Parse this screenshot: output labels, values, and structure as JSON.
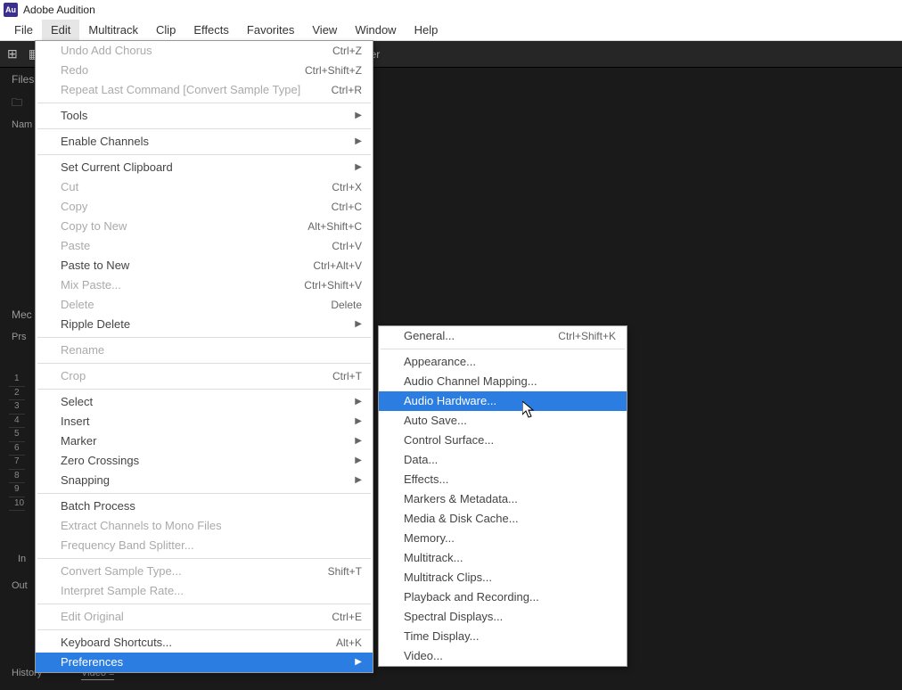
{
  "app": {
    "icon": "Au",
    "title": "Adobe Audition"
  },
  "menubar": [
    "File",
    "Edit",
    "Multitrack",
    "Clip",
    "Effects",
    "Favorites",
    "View",
    "Window",
    "Help"
  ],
  "activeMenu": 1,
  "toolbar": {
    "mixer": "Mixer"
  },
  "side": {
    "files": "Files",
    "name": "Nam",
    "mec": "Mec",
    "prs": "Prs",
    "in": "In",
    "out": "Out",
    "history": "History",
    "video": "Video  ≡"
  },
  "numlist": [
    "1",
    "2",
    "3",
    "4",
    "5",
    "6",
    "7",
    "8",
    "9",
    "10"
  ],
  "editMenu": [
    {
      "label": "Undo Add Chorus",
      "short": "Ctrl+Z",
      "dis": true
    },
    {
      "label": "Redo",
      "short": "Ctrl+Shift+Z",
      "dis": true
    },
    {
      "label": "Repeat Last Command [Convert Sample Type]",
      "short": "Ctrl+R",
      "dis": true
    },
    {
      "sep": true
    },
    {
      "label": "Tools",
      "sub": true
    },
    {
      "sep": true
    },
    {
      "label": "Enable Channels",
      "sub": true
    },
    {
      "sep": true
    },
    {
      "label": "Set Current Clipboard",
      "sub": true
    },
    {
      "label": "Cut",
      "short": "Ctrl+X",
      "dis": true
    },
    {
      "label": "Copy",
      "short": "Ctrl+C",
      "dis": true
    },
    {
      "label": "Copy to New",
      "short": "Alt+Shift+C",
      "dis": true
    },
    {
      "label": "Paste",
      "short": "Ctrl+V",
      "dis": true
    },
    {
      "label": "Paste to New",
      "short": "Ctrl+Alt+V"
    },
    {
      "label": "Mix Paste...",
      "short": "Ctrl+Shift+V",
      "dis": true
    },
    {
      "label": "Delete",
      "short": "Delete",
      "dis": true
    },
    {
      "label": "Ripple Delete",
      "sub": true
    },
    {
      "sep": true
    },
    {
      "label": "Rename",
      "dis": true
    },
    {
      "sep": true
    },
    {
      "label": "Crop",
      "short": "Ctrl+T",
      "dis": true
    },
    {
      "sep": true
    },
    {
      "label": "Select",
      "sub": true
    },
    {
      "label": "Insert",
      "sub": true
    },
    {
      "label": "Marker",
      "sub": true
    },
    {
      "label": "Zero Crossings",
      "sub": true
    },
    {
      "label": "Snapping",
      "sub": true
    },
    {
      "sep": true
    },
    {
      "label": "Batch Process"
    },
    {
      "label": "Extract Channels to Mono Files",
      "dis": true
    },
    {
      "label": "Frequency Band Splitter...",
      "dis": true
    },
    {
      "sep": true
    },
    {
      "label": "Convert Sample Type...",
      "short": "Shift+T",
      "dis": true
    },
    {
      "label": "Interpret Sample Rate...",
      "dis": true
    },
    {
      "sep": true
    },
    {
      "label": "Edit Original",
      "short": "Ctrl+E",
      "dis": true
    },
    {
      "sep": true
    },
    {
      "label": "Keyboard Shortcuts...",
      "short": "Alt+K"
    },
    {
      "label": "Preferences",
      "sub": true,
      "hl": true
    }
  ],
  "prefsMenu": [
    {
      "label": "General...",
      "short": "Ctrl+Shift+K"
    },
    {
      "sep": true
    },
    {
      "label": "Appearance..."
    },
    {
      "label": "Audio Channel Mapping..."
    },
    {
      "label": "Audio Hardware...",
      "hl": true
    },
    {
      "label": "Auto Save..."
    },
    {
      "label": "Control Surface..."
    },
    {
      "label": "Data..."
    },
    {
      "label": "Effects..."
    },
    {
      "label": "Markers & Metadata..."
    },
    {
      "label": "Media & Disk Cache..."
    },
    {
      "label": "Memory..."
    },
    {
      "label": "Multitrack..."
    },
    {
      "label": "Multitrack Clips..."
    },
    {
      "label": "Playback and Recording..."
    },
    {
      "label": "Spectral Displays..."
    },
    {
      "label": "Time Display..."
    },
    {
      "label": "Video..."
    }
  ]
}
